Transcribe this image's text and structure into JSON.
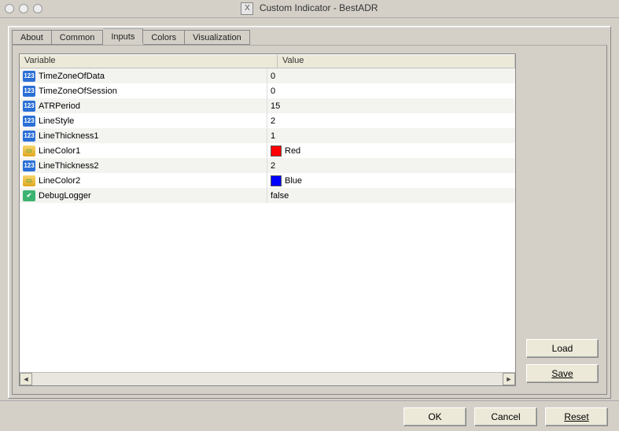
{
  "window": {
    "icon_label": "X",
    "title": "Custom Indicator - BestADR"
  },
  "tabs": [
    {
      "label": "About"
    },
    {
      "label": "Common"
    },
    {
      "label": "Inputs",
      "active": true
    },
    {
      "label": "Colors"
    },
    {
      "label": "Visualization"
    }
  ],
  "grid": {
    "columns": {
      "variable": "Variable",
      "value": "Value"
    },
    "rows": [
      {
        "icon": "int",
        "name": "TimeZoneOfData",
        "value": "0"
      },
      {
        "icon": "int",
        "name": "TimeZoneOfSession",
        "value": "0"
      },
      {
        "icon": "int",
        "name": "ATRPeriod",
        "value": "15"
      },
      {
        "icon": "int",
        "name": "LineStyle",
        "value": "2"
      },
      {
        "icon": "int",
        "name": "LineThickness1",
        "value": "1"
      },
      {
        "icon": "color",
        "name": "LineColor1",
        "value": "Red",
        "swatch": "#ff0000"
      },
      {
        "icon": "int",
        "name": "LineThickness2",
        "value": "2"
      },
      {
        "icon": "color",
        "name": "LineColor2",
        "value": "Blue",
        "swatch": "#0000ff"
      },
      {
        "icon": "bool",
        "name": "DebugLogger",
        "value": "false"
      }
    ]
  },
  "icons": {
    "int_glyph": "123",
    "color_glyph": "▭",
    "bool_glyph": "✔",
    "scroll_left": "◄",
    "scroll_right": "►"
  },
  "side_buttons": {
    "load": "Load",
    "save": "Save"
  },
  "bottom_buttons": {
    "ok": "OK",
    "cancel": "Cancel",
    "reset": "Reset"
  }
}
